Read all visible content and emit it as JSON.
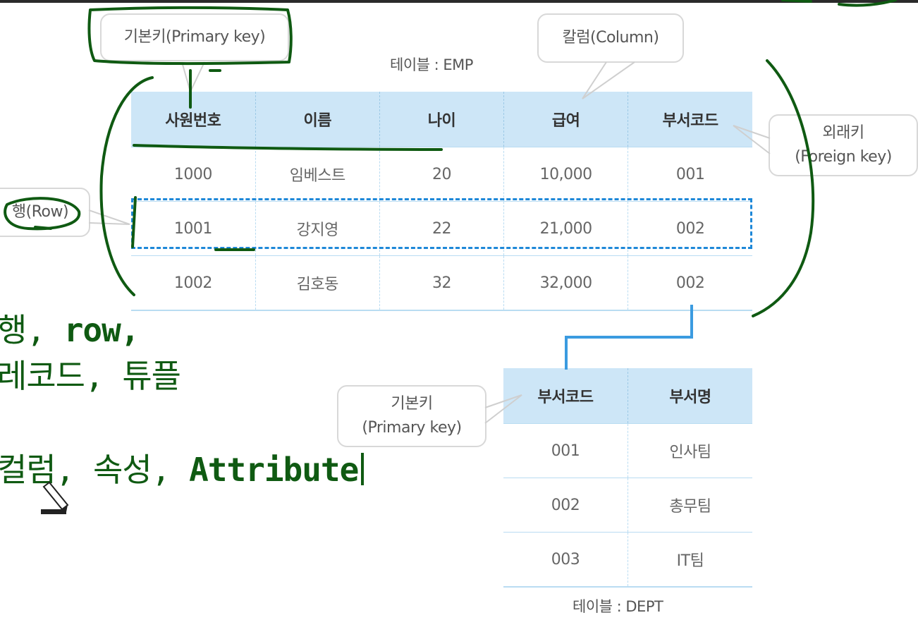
{
  "callouts": {
    "primary_key_top": "기본키(Primary key)",
    "column": "칼럼(Column)",
    "foreign_key_line1": "외래키",
    "foreign_key_line2": "(Foreign key)",
    "row": "행(Row)",
    "primary_key_dept_line1": "기본키",
    "primary_key_dept_line2": "(Primary key)"
  },
  "emp_table": {
    "caption": "테이블 : EMP",
    "headers": [
      "사원번호",
      "이름",
      "나이",
      "급여",
      "부서코드"
    ],
    "rows": [
      [
        "1000",
        "임베스트",
        "20",
        "10,000",
        "001"
      ],
      [
        "1001",
        "강지영",
        "22",
        "21,000",
        "002"
      ],
      [
        "1002",
        "김호동",
        "32",
        "32,000",
        "002"
      ]
    ]
  },
  "dept_table": {
    "caption": "테이블 : DEPT",
    "headers": [
      "부서코드",
      "부서명"
    ],
    "rows": [
      [
        "001",
        "인사팀"
      ],
      [
        "002",
        "총무팀"
      ],
      [
        "003",
        "IT팀"
      ]
    ]
  },
  "handwritten": {
    "line1_a": "행, ",
    "line1_b": "row,",
    "line2": "레코드, 튜플",
    "line3_a": "컬럼, 속성, ",
    "line3_b": "Attribute"
  },
  "colors": {
    "ink": "#0f5a12",
    "header_fill": "#cde6f7",
    "row_highlight": "#1e88d8"
  }
}
